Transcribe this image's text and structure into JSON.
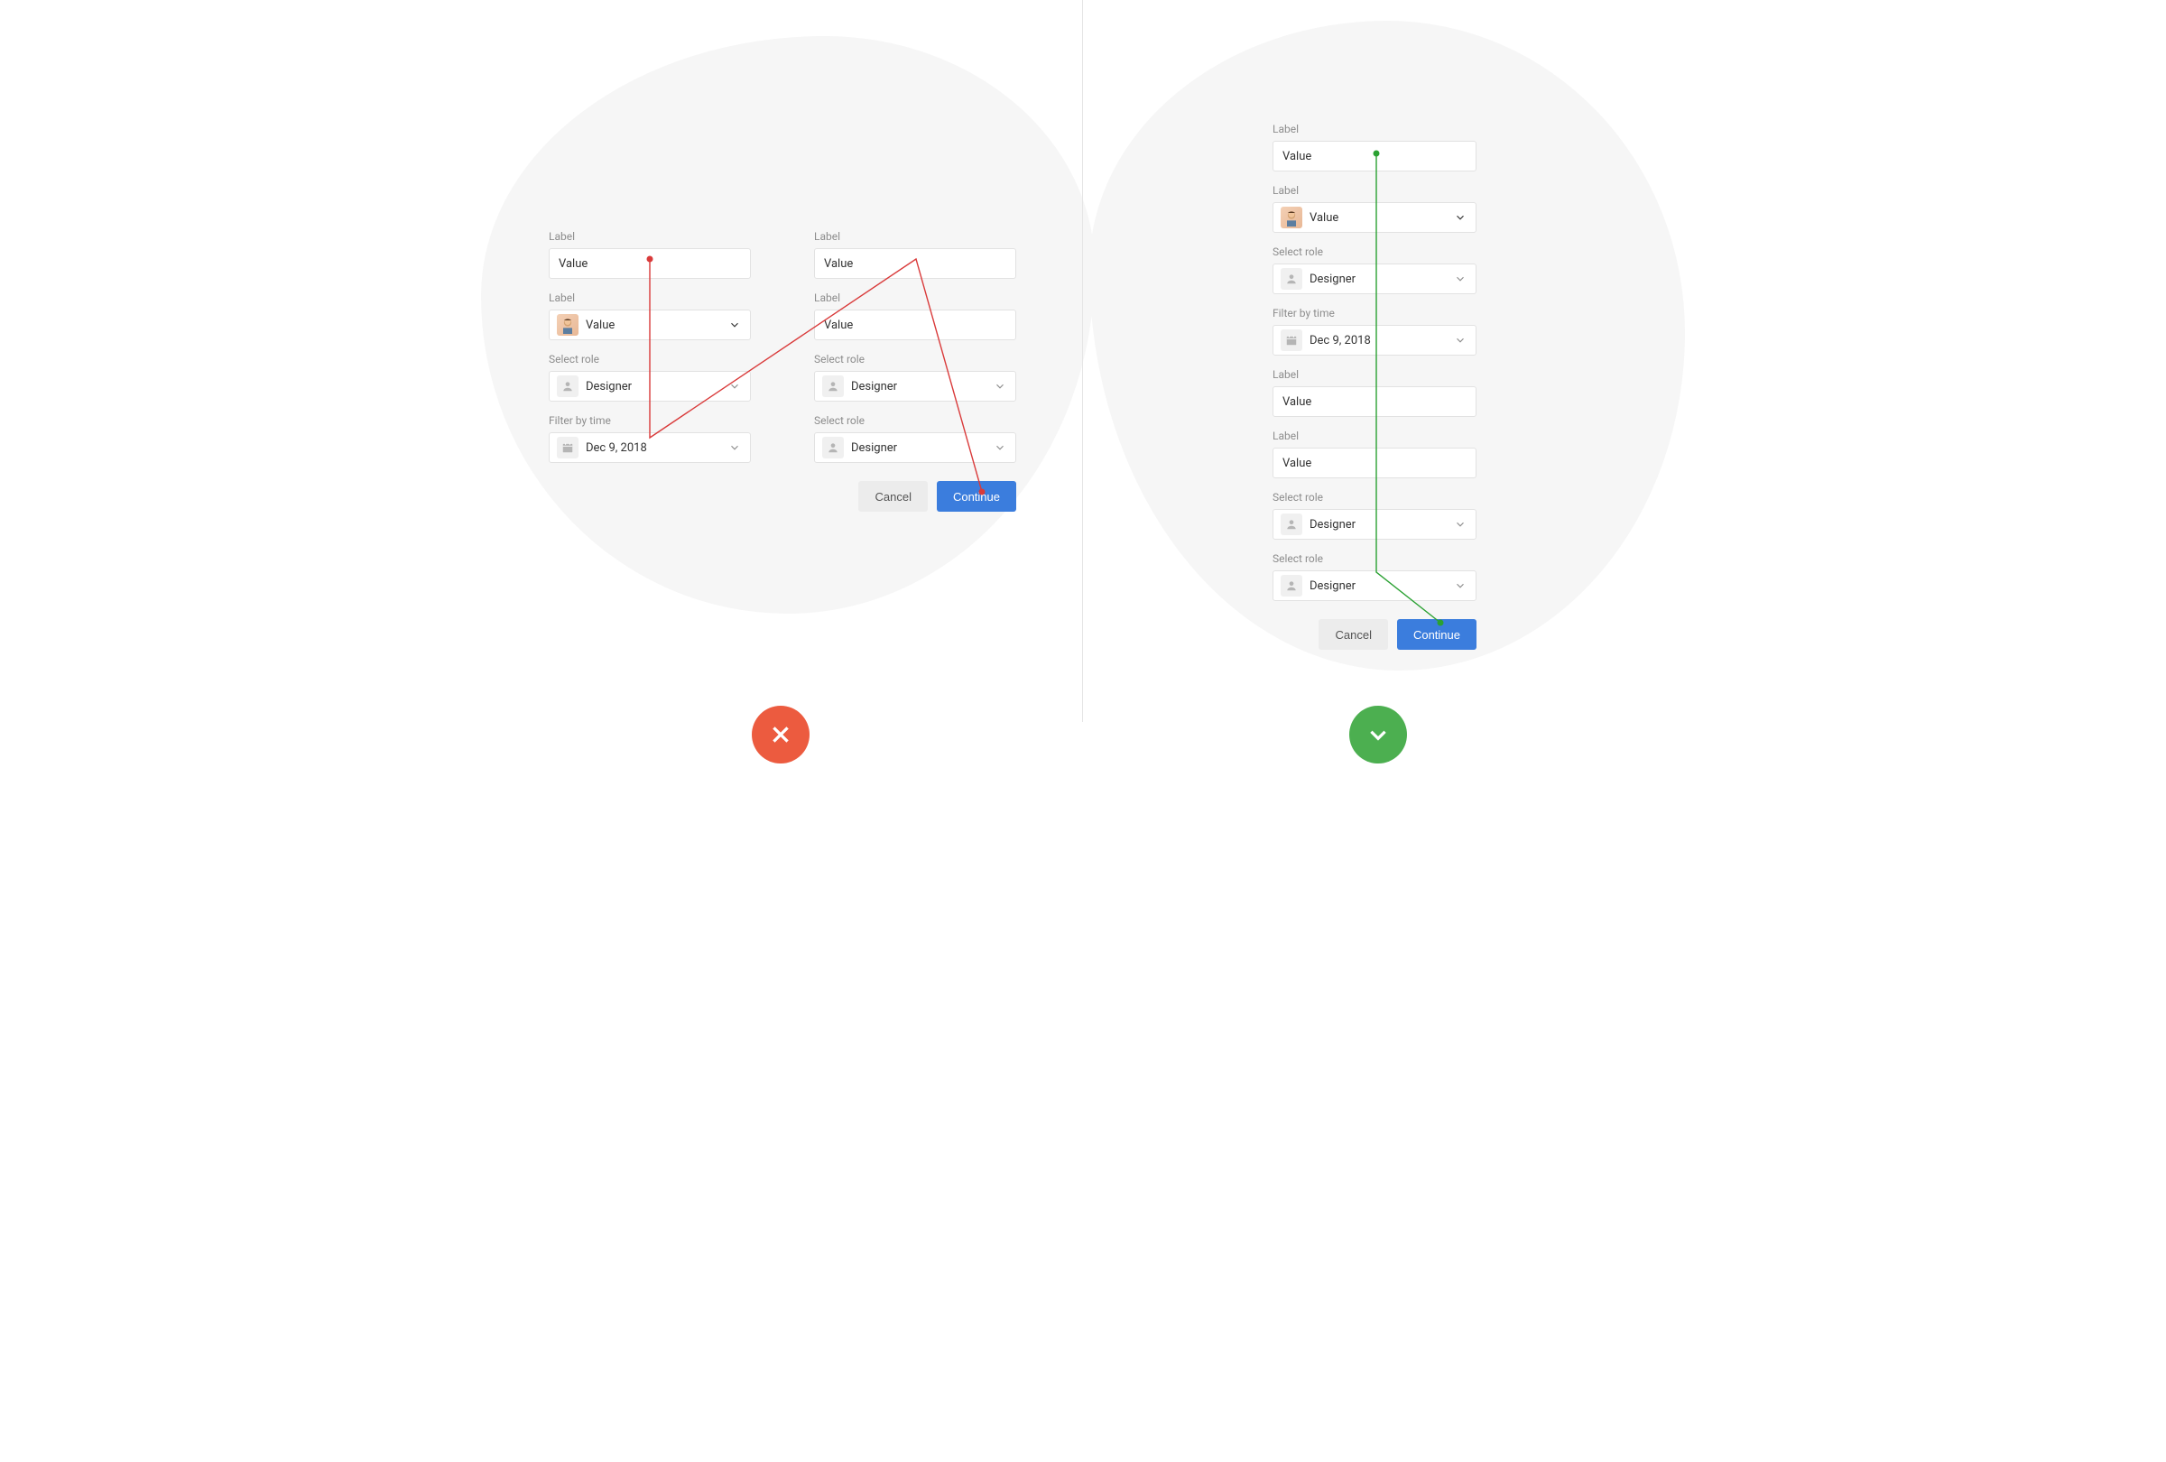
{
  "left": {
    "col1": [
      {
        "label": "Label",
        "value": "Value",
        "type": "text"
      },
      {
        "label": "Label",
        "value": "Value",
        "type": "avatar"
      },
      {
        "label": "Select role",
        "value": "Designer",
        "type": "role"
      },
      {
        "label": "Filter by time",
        "value": "Dec 9, 2018",
        "type": "date"
      }
    ],
    "col2": [
      {
        "label": "Label",
        "value": "Value",
        "type": "text"
      },
      {
        "label": "Label",
        "value": "Value",
        "type": "text"
      },
      {
        "label": "Select role",
        "value": "Designer",
        "type": "role"
      },
      {
        "label": "Select role",
        "value": "Designer",
        "type": "role"
      }
    ],
    "buttons": {
      "cancel": "Cancel",
      "continue": "Continue"
    }
  },
  "right": {
    "fields": [
      {
        "label": "Label",
        "value": "Value",
        "type": "text"
      },
      {
        "label": "Label",
        "value": "Value",
        "type": "avatar"
      },
      {
        "label": "Select role",
        "value": "Designer",
        "type": "role"
      },
      {
        "label": "Filter by time",
        "value": "Dec 9, 2018",
        "type": "date"
      },
      {
        "label": "Label",
        "value": "Value",
        "type": "text"
      },
      {
        "label": "Label",
        "value": "Value",
        "type": "text"
      },
      {
        "label": "Select role",
        "value": "Designer",
        "type": "role"
      },
      {
        "label": "Select role",
        "value": "Designer",
        "type": "role"
      }
    ],
    "buttons": {
      "cancel": "Cancel",
      "continue": "Continue"
    }
  },
  "colors": {
    "primary": "#3b7ddd",
    "bad": "#ec5b3f",
    "good": "#4caf50",
    "flowBad": "#d93a3a",
    "flowGood": "#2aa132"
  }
}
